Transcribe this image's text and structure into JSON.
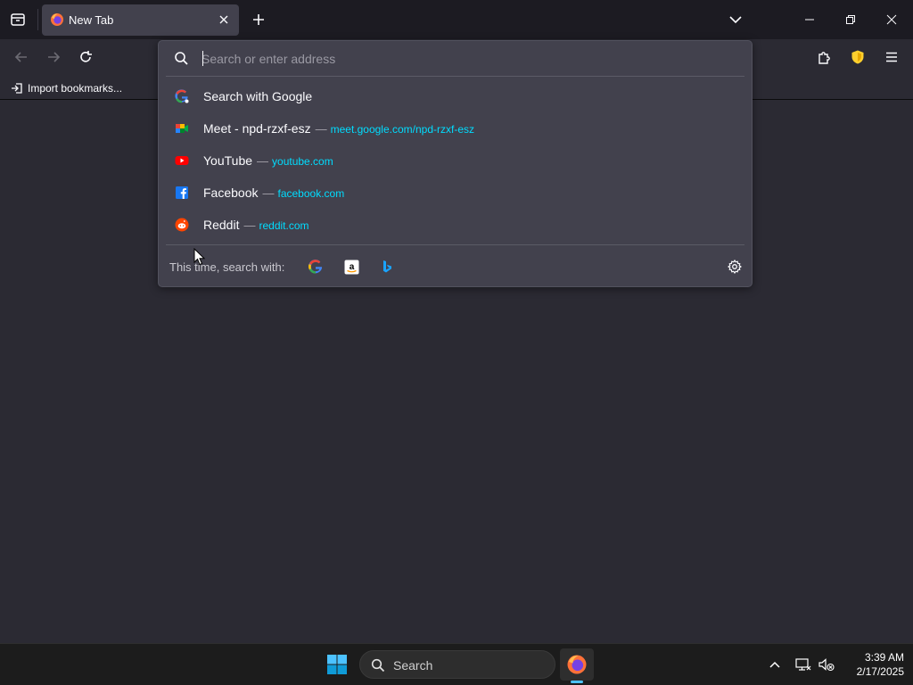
{
  "tabs": [
    {
      "title": "New Tab",
      "favicon": "firefox-icon"
    }
  ],
  "bookmarks": {
    "import_label": "Import bookmarks..."
  },
  "urlbar": {
    "placeholder": "Search or enter address",
    "value": "",
    "results": [
      {
        "icon": "google-search-icon",
        "title": "Search with Google",
        "url": ""
      },
      {
        "icon": "google-meet-icon",
        "title": "Meet - npd-rzxf-esz",
        "url": "meet.google.com/npd-rzxf-esz"
      },
      {
        "icon": "youtube-icon",
        "title": "YouTube",
        "url": "youtube.com"
      },
      {
        "icon": "facebook-icon",
        "title": "Facebook",
        "url": "facebook.com"
      },
      {
        "icon": "reddit-icon",
        "title": "Reddit",
        "url": "reddit.com"
      }
    ],
    "separator": "—",
    "oneoff_label": "This time, search with:",
    "engines": [
      "google-icon",
      "amazon-icon",
      "bing-icon"
    ]
  },
  "taskbar": {
    "search_label": "Search",
    "time": "3:39 AM",
    "date": "2/17/2025"
  },
  "colors": {
    "accent_url": "#00ddff",
    "urlbar_bg": "#42414d",
    "page_bg": "#2b2a33",
    "taskbar_indicator": "#4cc2ff"
  }
}
